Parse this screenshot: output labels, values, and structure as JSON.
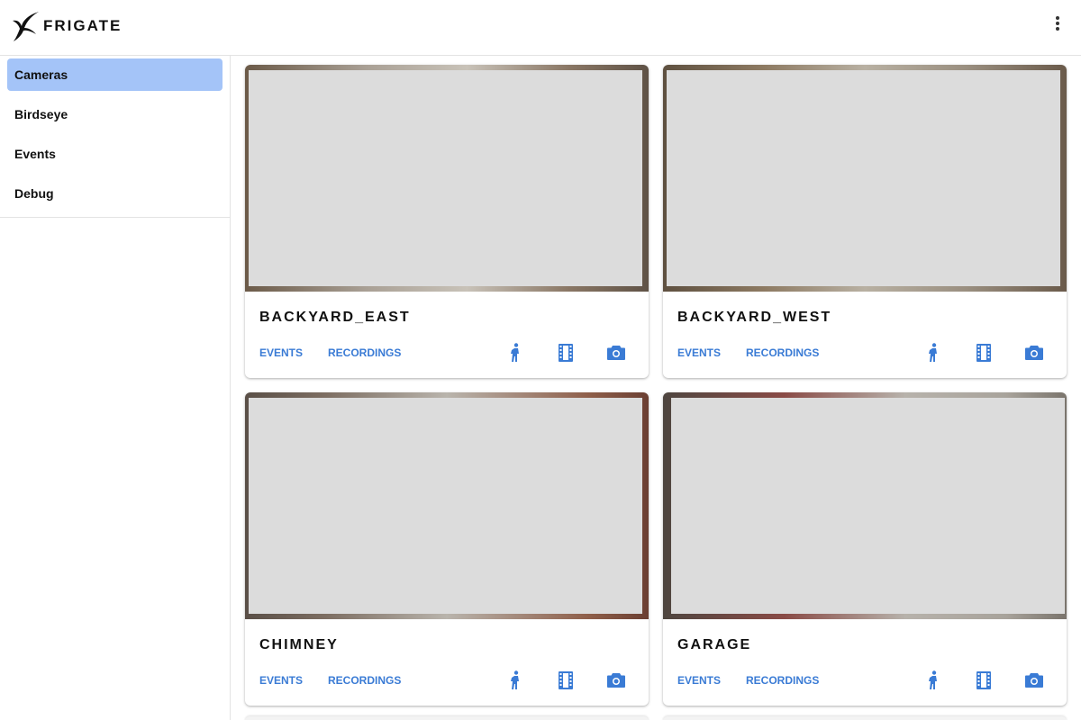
{
  "app": {
    "name": "FRIGATE",
    "logo_icon": "frigate-bird-icon",
    "menu_icon": "more-vertical-icon"
  },
  "sidebar": {
    "items": [
      {
        "label": "Cameras",
        "active": true
      },
      {
        "label": "Birdseye",
        "active": false
      },
      {
        "label": "Events",
        "active": false
      },
      {
        "label": "Debug",
        "active": false
      }
    ]
  },
  "cameras": [
    {
      "name": "BACKYARD_EAST",
      "events_label": "EVENTS",
      "recordings_label": "RECORDINGS"
    },
    {
      "name": "BACKYARD_WEST",
      "events_label": "EVENTS",
      "recordings_label": "RECORDINGS"
    },
    {
      "name": "CHIMNEY",
      "events_label": "EVENTS",
      "recordings_label": "RECORDINGS"
    },
    {
      "name": "GARAGE",
      "events_label": "EVENTS",
      "recordings_label": "RECORDINGS"
    }
  ],
  "card_icons": [
    "motion-person-icon",
    "recordings-film-icon",
    "snapshot-camera-icon"
  ],
  "colors": {
    "accent": "#3a7bd5",
    "active_nav": "#a4c4f8",
    "feed_placeholder": "#dcdcdc"
  }
}
